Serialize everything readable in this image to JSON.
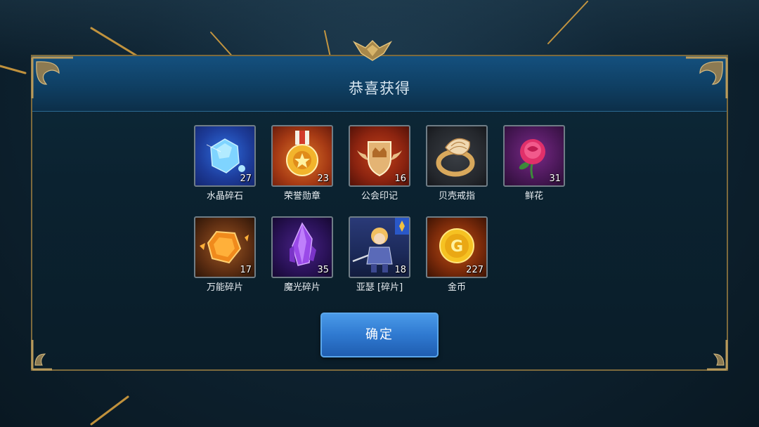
{
  "dialog": {
    "title": "恭喜获得",
    "confirm_label": "确定"
  },
  "rewards": [
    {
      "name": "水晶碎石",
      "count": "27",
      "icon": "blue-crystal-icon"
    },
    {
      "name": "荣誉勋章",
      "count": "23",
      "icon": "honor-medal-icon"
    },
    {
      "name": "公会印记",
      "count": "16",
      "icon": "guild-emblem-icon"
    },
    {
      "name": "贝壳戒指",
      "count": "",
      "icon": "shell-ring-icon"
    },
    {
      "name": "鲜花",
      "count": "31",
      "icon": "rose-icon"
    },
    {
      "name": "万能碎片",
      "count": "17",
      "icon": "universal-shard-icon"
    },
    {
      "name": "魔光碎片",
      "count": "35",
      "icon": "purple-crystal-icon"
    },
    {
      "name": "亚瑟 [碎片]",
      "count": "18",
      "icon": "arthur-hero-icon"
    },
    {
      "name": "金币",
      "count": "227",
      "icon": "gold-coin-icon"
    }
  ],
  "colors": {
    "frame_gold": "#7d6a3c",
    "header_blue": "#14507e",
    "button_blue": "#2f79d0"
  }
}
